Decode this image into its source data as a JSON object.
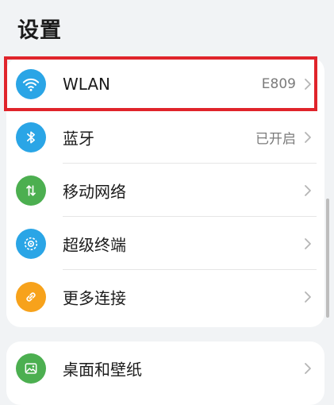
{
  "page": {
    "title": "设置"
  },
  "colors": {
    "highlight": "#e0242b",
    "wlan": "#2aa5e6",
    "bluetooth": "#2aa5e6",
    "mobile": "#4caf50",
    "superdevice": "#2aa5e6",
    "more": "#f7a21b",
    "desktop": "#4caf50"
  },
  "group1": [
    {
      "id": "wlan",
      "label": "WLAN",
      "value": "E809",
      "icon": "wifi-icon"
    },
    {
      "id": "bluetooth",
      "label": "蓝牙",
      "value": "已开启",
      "icon": "bluetooth-icon"
    },
    {
      "id": "mobile-network",
      "label": "移动网络",
      "value": "",
      "icon": "mobile-data-icon"
    },
    {
      "id": "super-device",
      "label": "超级终端",
      "value": "",
      "icon": "super-device-icon"
    },
    {
      "id": "more-connections",
      "label": "更多连接",
      "value": "",
      "icon": "link-icon"
    }
  ],
  "group2": [
    {
      "id": "desktop-wallpaper",
      "label": "桌面和壁纸",
      "value": "",
      "icon": "wallpaper-icon"
    }
  ]
}
